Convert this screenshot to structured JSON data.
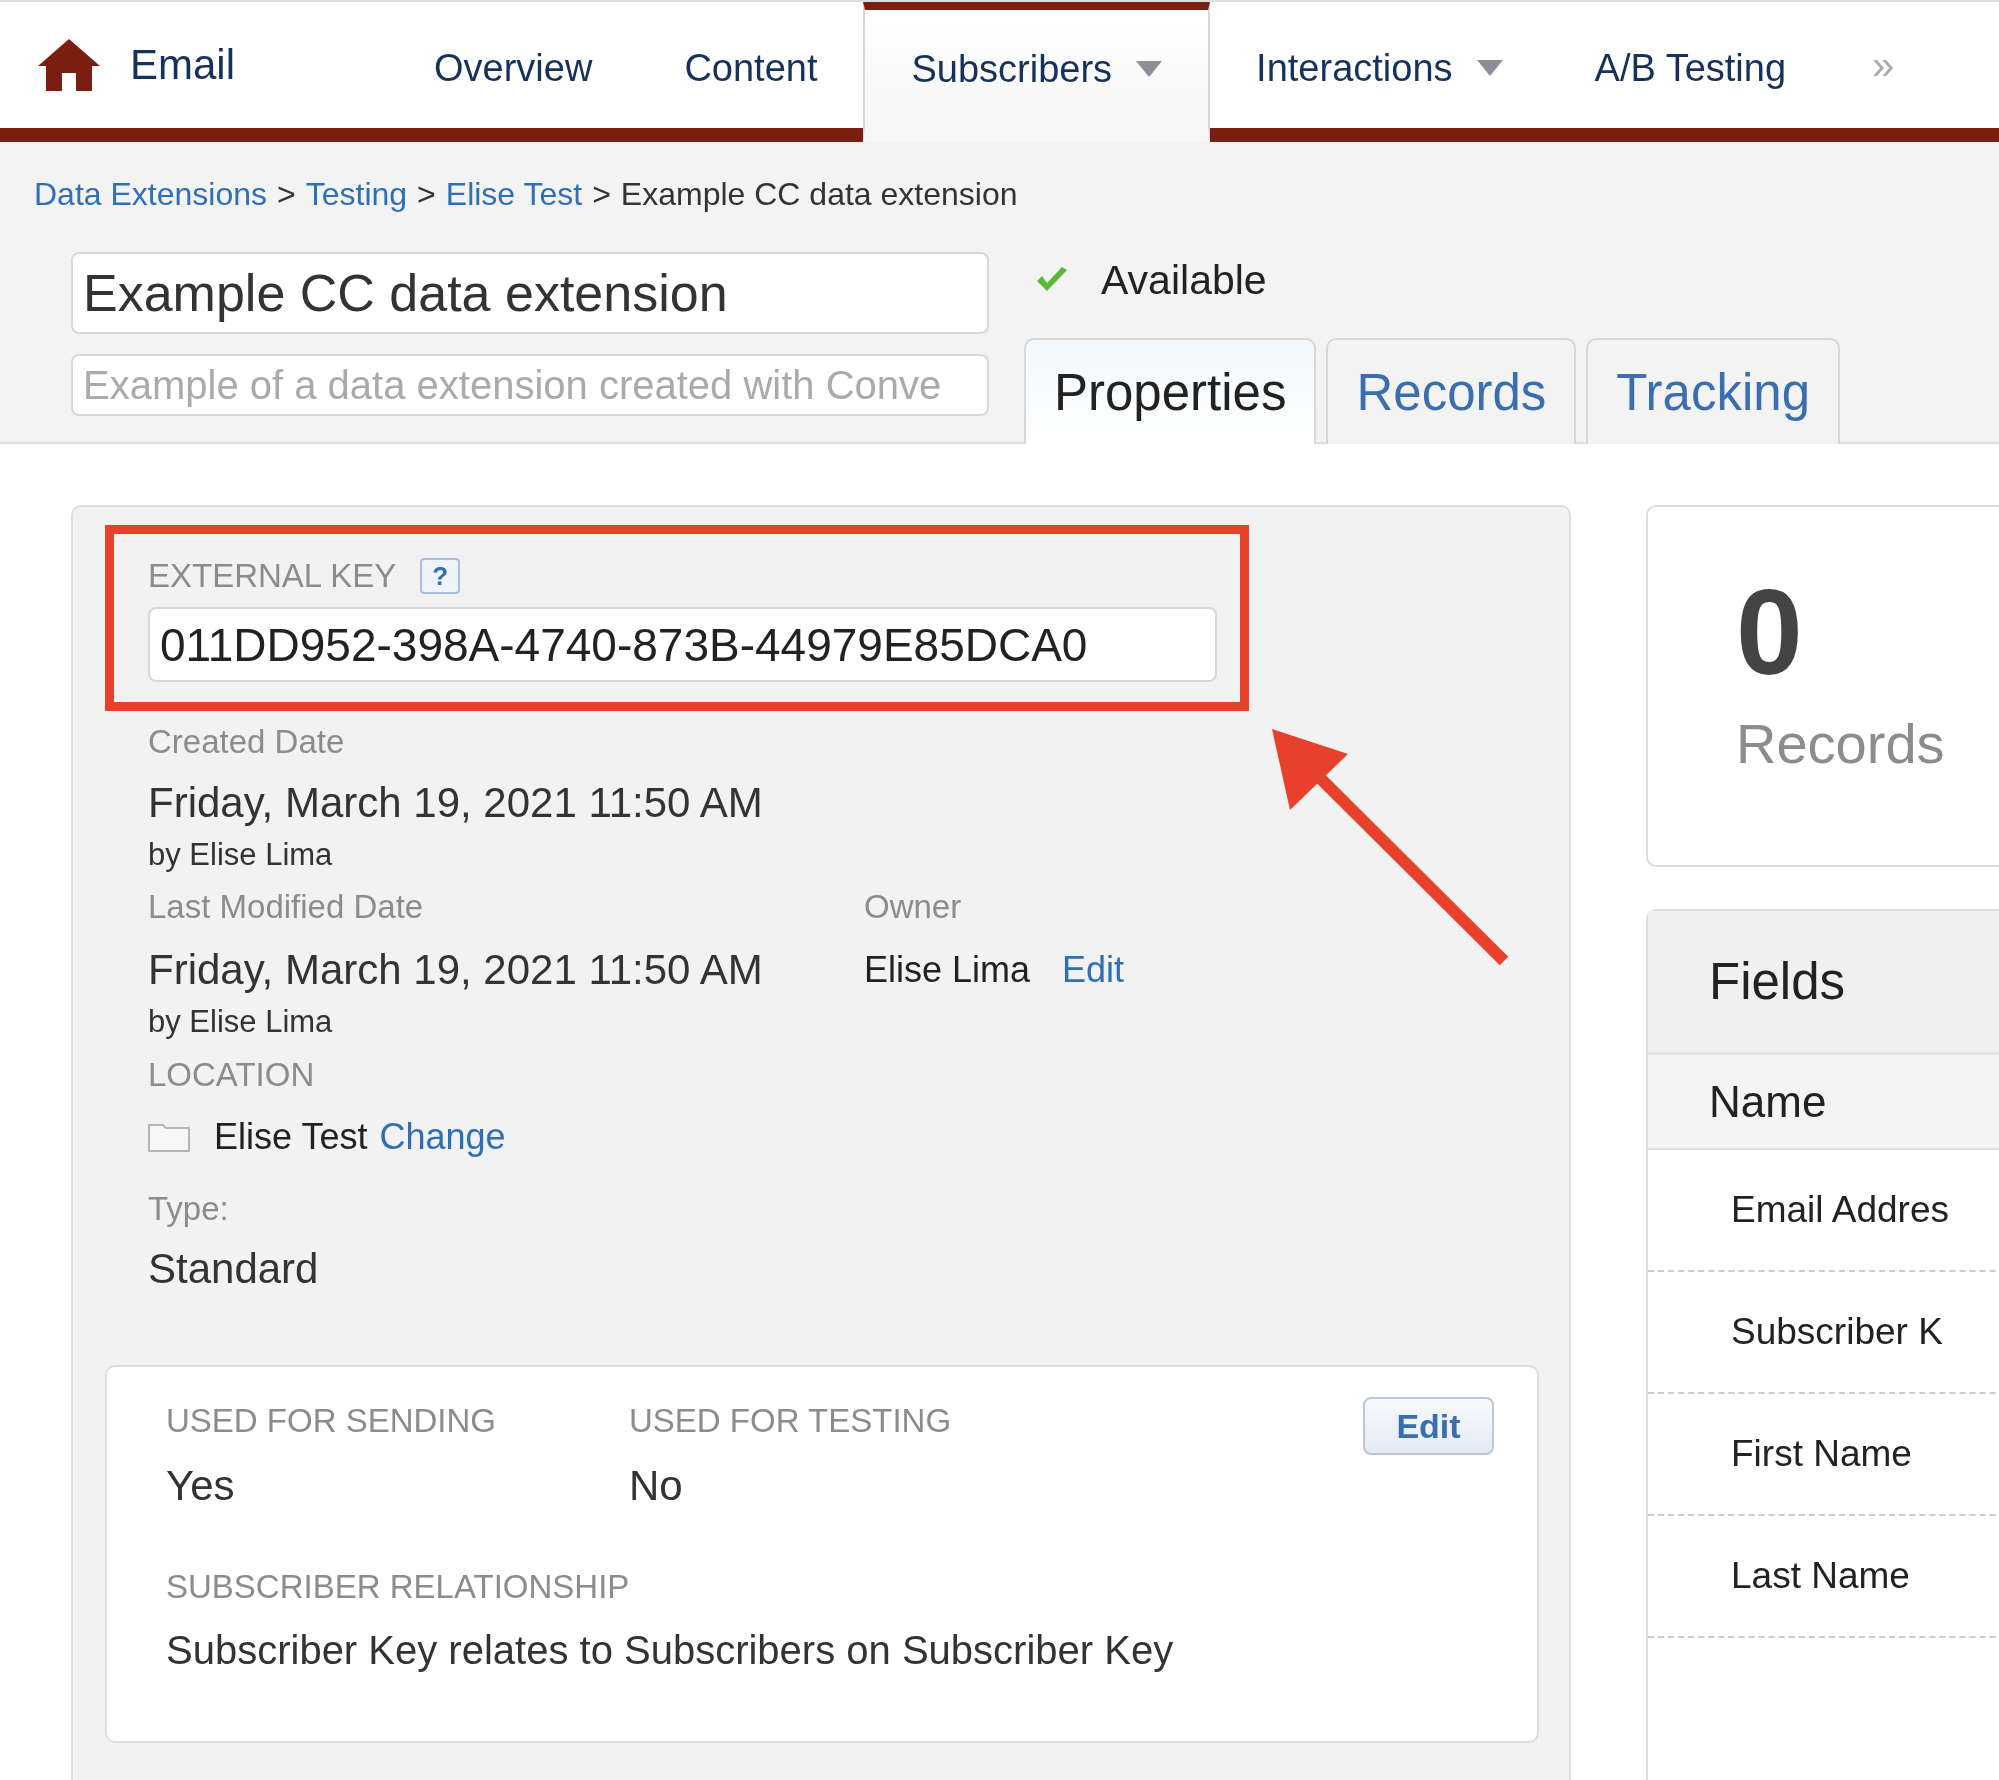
{
  "nav": {
    "app_title": "Email",
    "more": "»",
    "items": [
      {
        "label": "Overview",
        "selected": false,
        "dropdown": false
      },
      {
        "label": "Content",
        "selected": false,
        "dropdown": false
      },
      {
        "label": "Subscribers",
        "selected": true,
        "dropdown": true
      },
      {
        "label": "Interactions",
        "selected": false,
        "dropdown": true
      },
      {
        "label": "A/B Testing",
        "selected": false,
        "dropdown": false
      }
    ]
  },
  "breadcrumb": {
    "links": [
      {
        "label": "Data Extensions",
        "separator": ">"
      },
      {
        "label": "Testing",
        "separator": ">"
      },
      {
        "label": "Elise Test",
        "separator": ">"
      }
    ],
    "current": "Example CC data extension"
  },
  "header": {
    "name": "Example CC data extension",
    "description": "Example of a data extension created with Conve",
    "status": "Available"
  },
  "tabs": [
    {
      "label": "Properties",
      "selected": true
    },
    {
      "label": "Records",
      "selected": false
    },
    {
      "label": "Tracking",
      "selected": false
    }
  ],
  "properties": {
    "external_key": {
      "label": "EXTERNAL KEY",
      "help": "?",
      "value": "011DD952-398A-4740-873B-44979E85DCA0"
    },
    "created": {
      "label": "Created Date",
      "date": "Friday, March 19, 2021 11:50 AM",
      "by": "by Elise Lima"
    },
    "modified": {
      "label": "Last Modified Date",
      "date": "Friday, March 19, 2021 11:50 AM",
      "by": "by Elise Lima"
    },
    "owner": {
      "label": "Owner",
      "name": "Elise Lima",
      "action": "Edit"
    },
    "location": {
      "label": "LOCATION",
      "folder": "Elise Test",
      "action": "Change"
    },
    "type": {
      "label": "Type:",
      "value": "Standard"
    },
    "usage": {
      "edit": "Edit",
      "sending": {
        "label": "USED FOR SENDING",
        "value": "Yes"
      },
      "testing": {
        "label": "USED FOR TESTING",
        "value": "No"
      },
      "relationship": {
        "label": "SUBSCRIBER RELATIONSHIP",
        "value": "Subscriber Key relates to Subscribers on Subscriber Key"
      }
    }
  },
  "summary": {
    "count": "0",
    "label": "Records"
  },
  "fields": {
    "title": "Fields",
    "column": "Name",
    "rows": [
      "Email Addres",
      "Subscriber K",
      "First Name",
      "Last Name"
    ]
  }
}
